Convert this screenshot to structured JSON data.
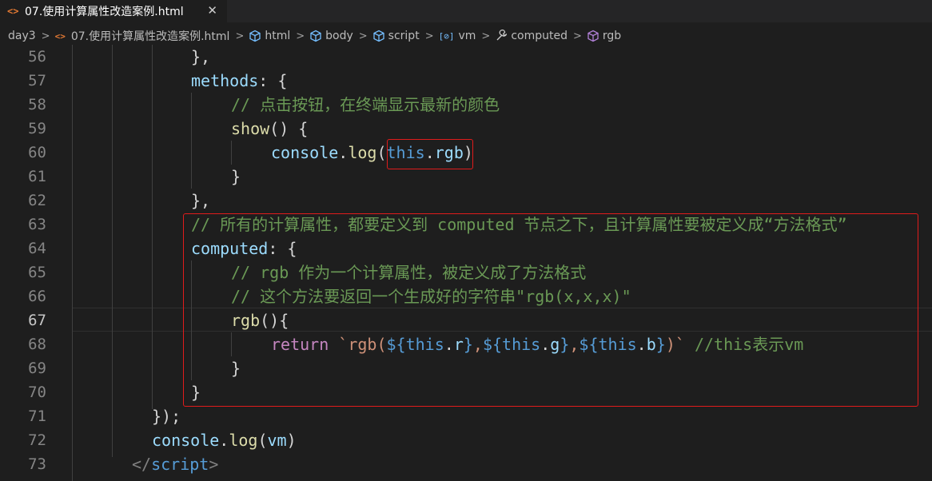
{
  "tab": {
    "icon": "<>",
    "title": "07.使用计算属性改造案例.html",
    "close": "✕"
  },
  "breadcrumb": {
    "items": [
      {
        "label": "day3",
        "icon": "folder"
      },
      {
        "label": "07.使用计算属性改造案例.html",
        "icon": "html-file-icon"
      },
      {
        "label": "html",
        "icon": "cube-icon"
      },
      {
        "label": "body",
        "icon": "cube-icon"
      },
      {
        "label": "script",
        "icon": "cube-icon"
      },
      {
        "label": "vm",
        "icon": "variable-icon"
      },
      {
        "label": "computed",
        "icon": "wrench-icon"
      },
      {
        "label": "rgb",
        "icon": "method-icon"
      }
    ],
    "separator": ">",
    "vm_icon_text": "[⊘]"
  },
  "editor": {
    "active_line": 67,
    "lines": [
      {
        "num": "56",
        "text": "},"
      },
      {
        "num": "57",
        "key": "methods",
        "rest": ": {"
      },
      {
        "num": "58",
        "text": "// 点击按钮，在终端显示最新的颜色"
      },
      {
        "num": "59",
        "fn": "show",
        "rest": "() {"
      },
      {
        "num": "60",
        "obj": "console",
        "dot": ".",
        "method": "log",
        "open": "(",
        "this": "this",
        "prop_dot": ".",
        "prop": "rgb",
        "close": ")"
      },
      {
        "num": "61",
        "text": "}"
      },
      {
        "num": "62",
        "text": "},"
      },
      {
        "num": "63",
        "text": "// 所有的计算属性，都要定义到 computed 节点之下，且计算属性要被定义成“方法格式”"
      },
      {
        "num": "64",
        "key": "computed",
        "rest": ": {"
      },
      {
        "num": "65",
        "text": "// rgb 作为一个计算属性，被定义成了方法格式"
      },
      {
        "num": "66",
        "text": "// 这个方法要返回一个生成好的字符串\"rgb(x,x,x)\""
      },
      {
        "num": "67",
        "fn": "rgb",
        "rest": "(){"
      },
      {
        "num": "68",
        "kw": "return",
        "str1": " `rgb(",
        "i1o": "${",
        "t1": "this",
        "d1": ".",
        "p1": "r",
        "i1c": "}",
        "c1": ",",
        "i2o": "${",
        "t2": "this",
        "d2": ".",
        "p2": "g",
        "i2c": "}",
        "c2": ",",
        "i3o": "${",
        "t3": "this",
        "d3": ".",
        "p3": "b",
        "i3c": "}",
        "str2": ")`",
        "comment": " //this表示vm"
      },
      {
        "num": "69",
        "text": "}"
      },
      {
        "num": "70",
        "text": "}"
      },
      {
        "num": "71",
        "text": "});"
      },
      {
        "num": "72",
        "obj": "console",
        "dot": ".",
        "method": "log",
        "open": "(",
        "arg": "vm",
        "close": ")"
      },
      {
        "num": "73",
        "tag_open": "</",
        "tag": "script",
        "tag_close": ">"
      }
    ]
  },
  "colors": {
    "highlight_box": "#e01b1b",
    "keyword": "#569cd6",
    "control_keyword": "#c586c0",
    "function": "#dcdcaa",
    "variable": "#9cdcfe",
    "comment": "#6a9955",
    "string": "#ce9178"
  }
}
